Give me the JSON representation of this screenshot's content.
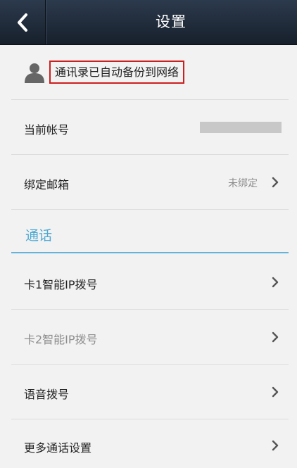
{
  "header": {
    "title": "设置"
  },
  "backup": {
    "text": "通讯录已自动备份到网络"
  },
  "account": {
    "label": "当前帐号"
  },
  "email": {
    "label": "绑定邮箱",
    "status": "未绑定"
  },
  "section": {
    "title": "通话"
  },
  "items": [
    {
      "label": "卡1智能IP拨号"
    },
    {
      "label": "卡2智能IP拨号"
    },
    {
      "label": "语音拨号"
    },
    {
      "label": "更多通话设置"
    }
  ],
  "icons": {
    "back": "chevron-left-icon",
    "person": "person-icon",
    "chevron": "chevron-right-icon"
  },
  "colors": {
    "header": "#1d2735",
    "section": "#4ba8d3",
    "highlight": "#cc1f1f"
  }
}
